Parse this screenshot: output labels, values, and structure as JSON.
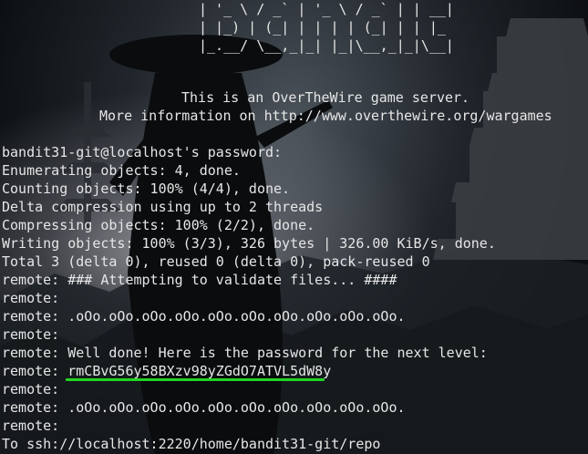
{
  "banner": {
    "art": [
      "| '_ \\ / _` | '_ \\ / _` | | __|",
      "| |_) | (_| | | | | (_| | | |_ ",
      "|_.__/ \\__,_|_| |_|\\__,_|_|\\__|"
    ],
    "server_notice": "This is an OverTheWire game server.",
    "more_info": "More information on http://www.overthewire.org/wargames"
  },
  "output": [
    "bandit31-git@localhost's password:",
    "Enumerating objects: 4, done.",
    "Counting objects: 100% (4/4), done.",
    "Delta compression using up to 2 threads",
    "Compressing objects: 100% (2/2), done.",
    "Writing objects: 100% (3/3), 326 bytes | 326.00 KiB/s, done.",
    "Total 3 (delta 0), reused 0 (delta 0), pack-reused 0",
    "remote: ### Attempting to validate files... ####",
    "remote:",
    "remote: .oOo.oOo.oOo.oOo.oOo.oOo.oOo.oOo.oOo.oOo.",
    "remote:",
    "remote: Well done! Here is the password for the next level:",
    "remote: rmCBvG56y58BXzv98yZGdO7ATVL5dW8y",
    "remote:",
    "remote: .oOo.oOo.oOo.oOo.oOo.oOo.oOo.oOo.oOo.oOo.",
    "remote:",
    "To ssh://localhost:2220/home/bandit31-git/repo"
  ],
  "password_prefix": "remote: ",
  "password": "rmCBvG56y58BXzv98yZGdO7ATVL5dW8y",
  "colors": {
    "text": "#e6e6e6",
    "underline": "#22d322",
    "background": "#0c1014"
  }
}
